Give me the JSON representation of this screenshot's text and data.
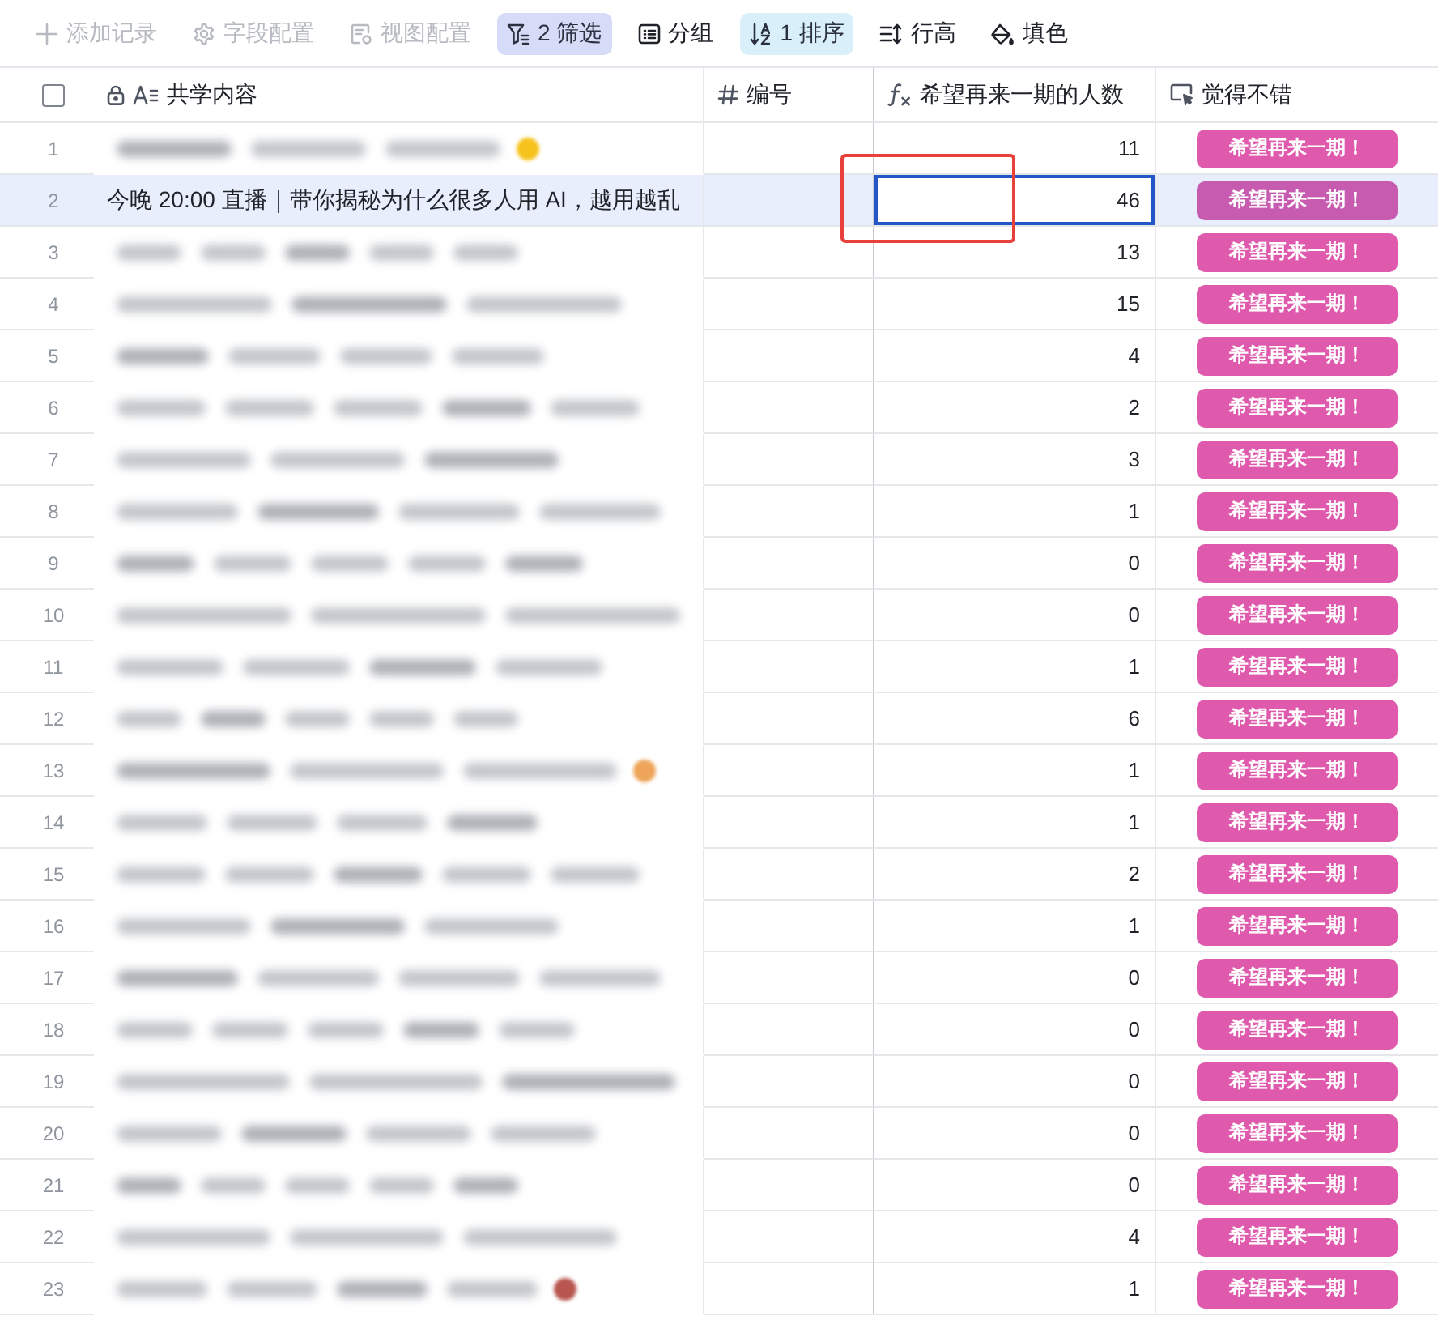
{
  "toolbar": {
    "items": [
      {
        "kind": "add",
        "label": "添加记录",
        "disabled": true,
        "active": false
      },
      {
        "kind": "fields",
        "label": "字段配置",
        "disabled": true,
        "active": false
      },
      {
        "kind": "view",
        "label": "视图配置",
        "disabled": true,
        "active": false
      },
      {
        "kind": "filter",
        "label": "2 筛选",
        "disabled": false,
        "active": true,
        "color": "#d6dcf8"
      },
      {
        "kind": "group",
        "label": "分组",
        "disabled": false,
        "active": false
      },
      {
        "kind": "sort",
        "label": "1 排序",
        "disabled": false,
        "active": true,
        "color": "#d9effa"
      },
      {
        "kind": "row-height",
        "label": "行高",
        "disabled": false,
        "active": false
      },
      {
        "kind": "fill",
        "label": "填色",
        "disabled": false,
        "active": false
      }
    ]
  },
  "table": {
    "select_all": {
      "checked": false
    },
    "columns": [
      {
        "kind": "text",
        "label": "共学内容",
        "locked": true
      },
      {
        "kind": "number",
        "label": "编号",
        "locked": false
      },
      {
        "kind": "formula",
        "label": "希望再来一期的人数",
        "locked": false
      },
      {
        "kind": "button",
        "label": "觉得不错",
        "locked": false
      }
    ],
    "rows": [
      {
        "index": "1",
        "content": {
          "kind": "blurred",
          "emoji": {
            "color": "#f6c21c"
          }
        },
        "count": "11",
        "action": "希望再来一期！",
        "selected": false,
        "focused": false,
        "annotated": false
      },
      {
        "index": "2",
        "content": {
          "kind": "text",
          "text": "今晚 20:00 直播｜带你揭秘为什么很多人用 AI，越用越乱"
        },
        "count": "46",
        "action": "希望再来一期！",
        "selected": true,
        "focused": true,
        "annotated": true
      },
      {
        "index": "3",
        "content": {
          "kind": "blurred"
        },
        "count": "13",
        "action": "希望再来一期！",
        "selected": false,
        "focused": false,
        "annotated": false
      },
      {
        "index": "4",
        "content": {
          "kind": "blurred"
        },
        "count": "15",
        "action": "希望再来一期！",
        "selected": false,
        "focused": false,
        "annotated": false
      },
      {
        "index": "5",
        "content": {
          "kind": "blurred"
        },
        "count": "4",
        "action": "希望再来一期！",
        "selected": false,
        "focused": false,
        "annotated": false
      },
      {
        "index": "6",
        "content": {
          "kind": "blurred"
        },
        "count": "2",
        "action": "希望再来一期！",
        "selected": false,
        "focused": false,
        "annotated": false
      },
      {
        "index": "7",
        "content": {
          "kind": "blurred"
        },
        "count": "3",
        "action": "希望再来一期！",
        "selected": false,
        "focused": false,
        "annotated": false
      },
      {
        "index": "8",
        "content": {
          "kind": "blurred"
        },
        "count": "1",
        "action": "希望再来一期！",
        "selected": false,
        "focused": false,
        "annotated": false
      },
      {
        "index": "9",
        "content": {
          "kind": "blurred"
        },
        "count": "0",
        "action": "希望再来一期！",
        "selected": false,
        "focused": false,
        "annotated": false
      },
      {
        "index": "10",
        "content": {
          "kind": "blurred"
        },
        "count": "0",
        "action": "希望再来一期！",
        "selected": false,
        "focused": false,
        "annotated": false
      },
      {
        "index": "11",
        "content": {
          "kind": "blurred"
        },
        "count": "1",
        "action": "希望再来一期！",
        "selected": false,
        "focused": false,
        "annotated": false
      },
      {
        "index": "12",
        "content": {
          "kind": "blurred"
        },
        "count": "6",
        "action": "希望再来一期！",
        "selected": false,
        "focused": false,
        "annotated": false
      },
      {
        "index": "13",
        "content": {
          "kind": "blurred",
          "emoji": {
            "color": "#eea45a"
          }
        },
        "count": "1",
        "action": "希望再来一期！",
        "selected": false,
        "focused": false,
        "annotated": false
      },
      {
        "index": "14",
        "content": {
          "kind": "blurred"
        },
        "count": "1",
        "action": "希望再来一期！",
        "selected": false,
        "focused": false,
        "annotated": false
      },
      {
        "index": "15",
        "content": {
          "kind": "blurred"
        },
        "count": "2",
        "action": "希望再来一期！",
        "selected": false,
        "focused": false,
        "annotated": false
      },
      {
        "index": "16",
        "content": {
          "kind": "blurred"
        },
        "count": "1",
        "action": "希望再来一期！",
        "selected": false,
        "focused": false,
        "annotated": false
      },
      {
        "index": "17",
        "content": {
          "kind": "blurred"
        },
        "count": "0",
        "action": "希望再来一期！",
        "selected": false,
        "focused": false,
        "annotated": false
      },
      {
        "index": "18",
        "content": {
          "kind": "blurred"
        },
        "count": "0",
        "action": "希望再来一期！",
        "selected": false,
        "focused": false,
        "annotated": false
      },
      {
        "index": "19",
        "content": {
          "kind": "blurred"
        },
        "count": "0",
        "action": "希望再来一期！",
        "selected": false,
        "focused": false,
        "annotated": false
      },
      {
        "index": "20",
        "content": {
          "kind": "blurred"
        },
        "count": "0",
        "action": "希望再来一期！",
        "selected": false,
        "focused": false,
        "annotated": false
      },
      {
        "index": "21",
        "content": {
          "kind": "blurred"
        },
        "count": "0",
        "action": "希望再来一期！",
        "selected": false,
        "focused": false,
        "annotated": false
      },
      {
        "index": "22",
        "content": {
          "kind": "blurred"
        },
        "count": "4",
        "action": "希望再来一期！",
        "selected": false,
        "focused": false,
        "annotated": false
      },
      {
        "index": "23",
        "content": {
          "kind": "blurred",
          "emoji": {
            "color": "#b8554f"
          }
        },
        "count": "1",
        "action": "希望再来一期！",
        "selected": false,
        "focused": false,
        "annotated": false
      }
    ]
  }
}
